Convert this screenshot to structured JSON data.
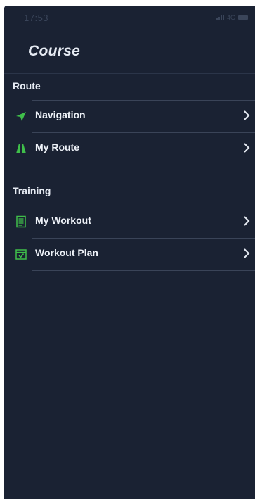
{
  "status_bar": {
    "time": "17:53",
    "network": "4G"
  },
  "page": {
    "title": "Course"
  },
  "sections": [
    {
      "label": "Route",
      "items": [
        {
          "label": "Navigation",
          "icon": "navigation-arrow-icon"
        },
        {
          "label": "My Route",
          "icon": "route-road-icon"
        }
      ]
    },
    {
      "label": "Training",
      "items": [
        {
          "label": "My Workout",
          "icon": "workout-list-icon"
        },
        {
          "label": "Workout Plan",
          "icon": "calendar-check-icon"
        }
      ]
    }
  ],
  "colors": {
    "background": "#1a2233",
    "accent": "#3fbf4a",
    "text": "#eef2f8",
    "divider": "#3a4458"
  }
}
